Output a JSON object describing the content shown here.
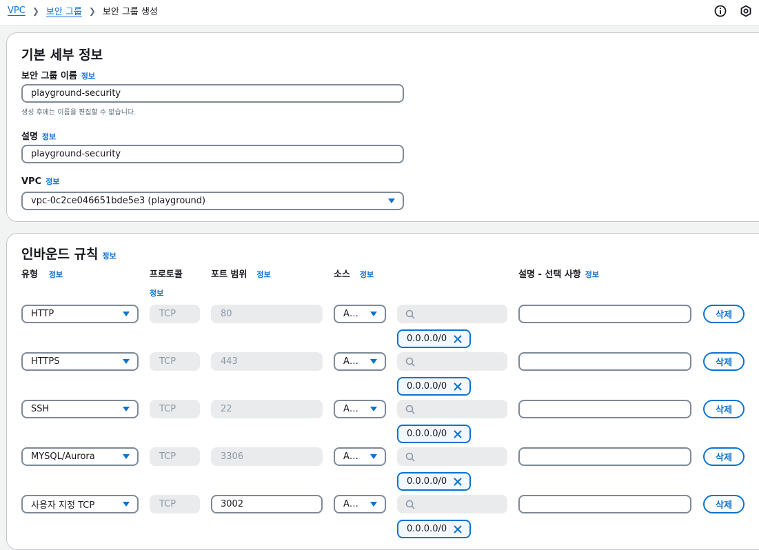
{
  "breadcrumb": {
    "vpc": "VPC",
    "security_groups": "보안 그룹",
    "current": "보안 그룹 생성"
  },
  "icons": {
    "info": "info-circle-icon",
    "settings": "settings-hexagon-icon",
    "search": "search-icon",
    "remove": "close-icon",
    "dropdown": "caret-down-icon"
  },
  "basic": {
    "title": "기본 세부 정보",
    "name_label": "보안 그룹 이름",
    "name_value": "playground-security",
    "name_hint": "생성 후에는 이름을 편집할 수 없습니다.",
    "desc_label": "설명",
    "desc_value": "playground-security",
    "vpc_label": "VPC",
    "vpc_value": "vpc-0c2ce046651bde5e3 (playground)"
  },
  "inbound": {
    "title": "인바운드 규칙",
    "headers": {
      "type": "유형",
      "protocol": "프로토콜",
      "port": "포트 범위",
      "source": "소스",
      "description": "설명 - 선택 사항"
    },
    "rules": [
      {
        "type": "HTTP",
        "protocol": "TCP",
        "port": "80",
        "source_type": "A…",
        "cidr": "0.0.0.0/0",
        "delete": "삭제"
      },
      {
        "type": "HTTPS",
        "protocol": "TCP",
        "port": "443",
        "source_type": "A…",
        "cidr": "0.0.0.0/0",
        "delete": "삭제"
      },
      {
        "type": "SSH",
        "protocol": "TCP",
        "port": "22",
        "source_type": "A…",
        "cidr": "0.0.0.0/0",
        "delete": "삭제"
      },
      {
        "type": "MYSQL/Aurora",
        "protocol": "TCP",
        "port": "3306",
        "source_type": "A…",
        "cidr": "0.0.0.0/0",
        "delete": "삭제"
      },
      {
        "type": "사용자 지정 TCP",
        "protocol": "TCP",
        "port": "3002",
        "source_type": "A…",
        "cidr": "0.0.0.0/0",
        "delete": "삭제"
      }
    ]
  },
  "info_label": "정보",
  "colors": {
    "accent": "#0972d3",
    "border": "#7d8998",
    "disabled_bg": "#e9ebed",
    "text": "#16191f"
  }
}
